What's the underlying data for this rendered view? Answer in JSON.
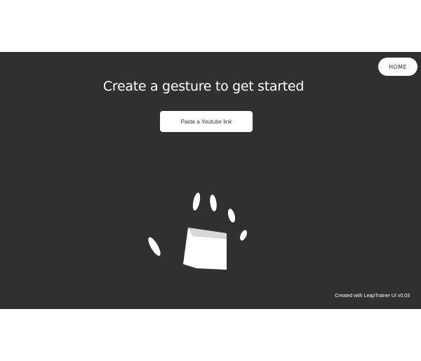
{
  "app": {
    "home_label": "HOME",
    "headline": "Create a gesture to get started",
    "youtube_placeholder": "Paste a Youtube link",
    "credit": "Created with LeapTrainer UI v0.03"
  },
  "colors": {
    "background": "#303030",
    "foreground": "#ffffff"
  },
  "visualization": {
    "shapes": [
      "palm",
      "thumb",
      "index-finger",
      "middle-finger",
      "ring-finger",
      "pinky-finger"
    ]
  }
}
